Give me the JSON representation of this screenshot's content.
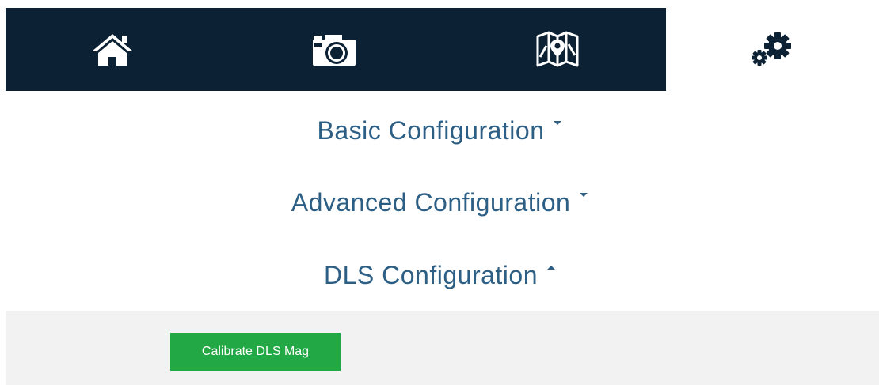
{
  "nav": {
    "tabs": [
      {
        "id": "home",
        "icon": "home-icon",
        "active": false
      },
      {
        "id": "camera",
        "icon": "camera-icon",
        "active": false
      },
      {
        "id": "map",
        "icon": "map-icon",
        "active": false
      },
      {
        "id": "settings",
        "icon": "gears-icon",
        "active": true
      }
    ],
    "colors": {
      "bar": "#0c2133",
      "icon": "#ffffff",
      "active_icon": "#0c2133"
    }
  },
  "sections": {
    "basic": {
      "label": "Basic Configuration",
      "expanded": false
    },
    "advanced": {
      "label": "Advanced Configuration",
      "expanded": false
    },
    "dls": {
      "label": "DLS Configuration",
      "expanded": true
    }
  },
  "dls_panel": {
    "calibrate_button": "Calibrate DLS Mag"
  },
  "colors": {
    "header_text": "#2d5f85",
    "panel_bg": "#f2f2f2",
    "button_bg": "#22a845",
    "button_text": "#ffffff"
  }
}
